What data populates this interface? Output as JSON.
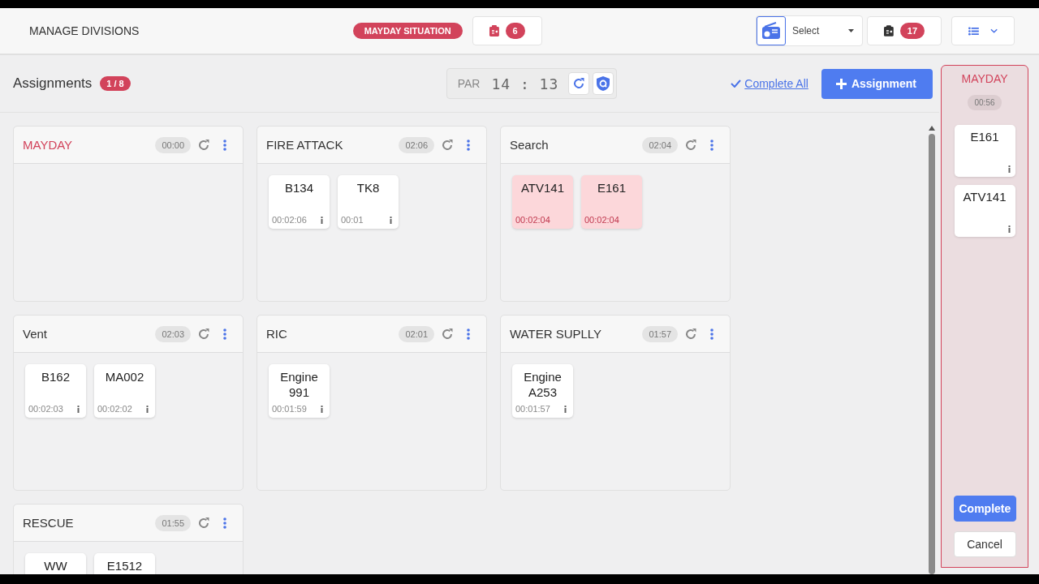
{
  "header": {
    "nav_item": "MANAGE DIVISIONS",
    "mayday_badge": "MAYDAY SITUATION",
    "clipboard_count": "6",
    "radio_select": {
      "placeholder": "Select"
    },
    "alerts_count": "17"
  },
  "toolbar": {
    "title": "Assignments",
    "count": "1 / 8",
    "par_label": "PAR",
    "par_time": "14 : 13",
    "complete_all": "Complete All",
    "add_button": "Assignment"
  },
  "divisions": [
    {
      "name": "MAYDAY",
      "kind": "mayday",
      "timer": "00:00"
    },
    {
      "name": "FIRE ATTACK",
      "kind": "normal",
      "timer": "02:06",
      "units": [
        {
          "name": "B134",
          "time": "00:02:06",
          "alert": false
        },
        {
          "name": "TK8",
          "time": "00:01",
          "alert": false
        }
      ]
    },
    {
      "name": "Search",
      "kind": "normal",
      "timer": "02:04",
      "units": [
        {
          "name": "ATV141",
          "time": "00:02:04",
          "alert": true
        },
        {
          "name": "E161",
          "time": "00:02:04",
          "alert": true
        }
      ]
    },
    {
      "name": "Vent",
      "kind": "normal",
      "timer": "02:03",
      "units": [
        {
          "name": "B162",
          "time": "00:02:03",
          "alert": false
        },
        {
          "name": "MA002",
          "time": "00:02:02",
          "alert": false
        }
      ]
    },
    {
      "name": "RIC",
      "kind": "normal",
      "timer": "02:01",
      "units": [
        {
          "name": "Engine 991",
          "time": "00:01:59",
          "alert": false
        }
      ]
    },
    {
      "name": "WATER SUPLLY",
      "kind": "normal",
      "timer": "01:57",
      "units": [
        {
          "name": "Engine A253",
          "time": "00:01:57",
          "alert": false
        }
      ]
    },
    {
      "name": "RESCUE",
      "kind": "normal",
      "timer": "01:55",
      "units": [
        {
          "name": "WW",
          "alert": false
        },
        {
          "name": "E1512",
          "alert": false
        }
      ]
    }
  ],
  "mayday_panel": {
    "title": "MAYDAY",
    "timer": "00:56",
    "units": [
      {
        "name": "E161"
      },
      {
        "name": "ATV141"
      }
    ],
    "buttons": [
      {
        "label": "Complete",
        "kind": "primary"
      },
      {
        "label": "Cancel",
        "kind": "secondary"
      }
    ]
  }
}
